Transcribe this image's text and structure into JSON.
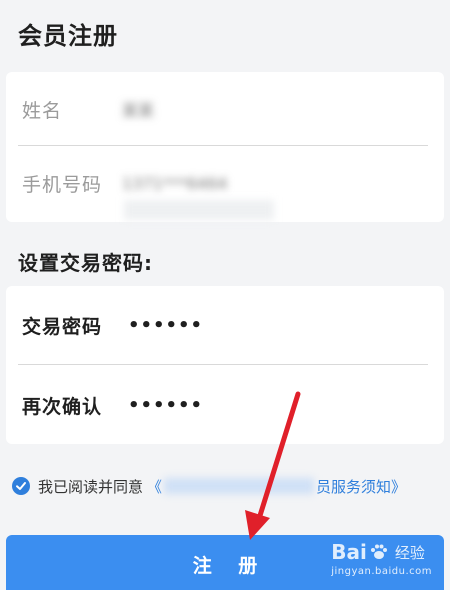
{
  "header": {
    "title": "会员注册"
  },
  "member_form": {
    "name_label": "姓名",
    "name_value": "某某",
    "phone_label": "手机号码",
    "phone_value": "1371***6464"
  },
  "password_section": {
    "title": "设置交易密码:",
    "trade_password_label": "交易密码",
    "trade_password_value": "••••••",
    "confirm_label": "再次确认",
    "confirm_value": "••••••"
  },
  "agreement": {
    "checked": true,
    "text": "我已阅读并同意",
    "link_open": "《",
    "link_tail": "员服务须知》"
  },
  "submit": {
    "label": "注 册"
  },
  "watermark": {
    "brand": "Bai",
    "brand_tail": "经验",
    "url": "jingyan.baidu.com"
  },
  "colors": {
    "accent": "#3b8ef0",
    "link": "#2f7fdc",
    "arrow": "#e0202a"
  }
}
